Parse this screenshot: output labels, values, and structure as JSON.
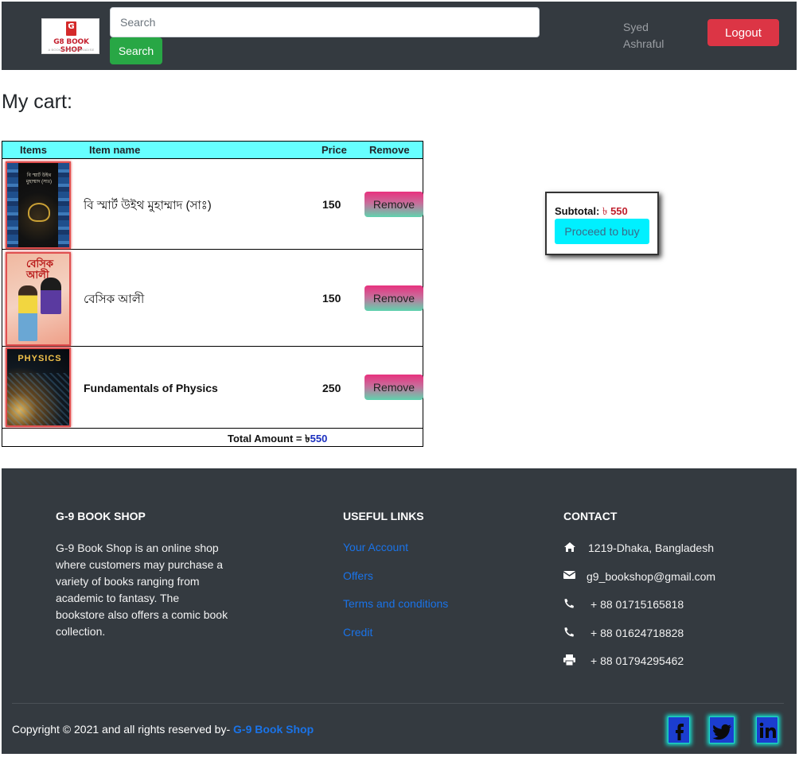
{
  "header": {
    "logo_name": "G8 BOOK SHOP",
    "logo_letter": "G",
    "logo_tagline": "A BOOK LOVERS PARADISE",
    "search_placeholder": "Search",
    "search_value": "",
    "search_button": "Search",
    "user_first": "Syed",
    "user_last": "Ashraful",
    "logout_button": "Logout"
  },
  "cart": {
    "heading": "My cart:",
    "columns": {
      "items": "Items",
      "name": "Item name",
      "price": "Price",
      "remove": "Remove"
    },
    "rows": [
      {
        "cover_title": "বি স্মার্ট উইথ মুহাম্মাদ (সাঃ)",
        "name": "বি স্মার্ট উইথ মুহাম্মাদ (সাঃ)",
        "price": "150",
        "remove_label": "Remove"
      },
      {
        "cover_title": "বেসিক আলী",
        "name": "বেসিক আলী",
        "price": "150",
        "remove_label": "Remove"
      },
      {
        "cover_title": "PHYSICS",
        "name": "Fundamentals of Physics",
        "price": "250",
        "remove_label": "Remove"
      }
    ],
    "total_label": "Total Amount =",
    "currency": "৳",
    "total_amount": "550"
  },
  "summary": {
    "subtotal_label": "Subtotal:",
    "currency": "৳",
    "subtotal_amount": "550",
    "proceed_button": "Proceed to buy"
  },
  "footer": {
    "about_heading": "G-9 BOOK SHOP",
    "about_text": "G-9 Book Shop is an online shop where customers may purchase a variety of books ranging from academic to fantasy. The bookstore also offers a comic book collection.",
    "links_heading": "USEFUL LINKS",
    "links": [
      "Your Account",
      "Offers",
      "Terms and conditions",
      "Credit"
    ],
    "contact_heading": "CONTACT",
    "contacts": [
      {
        "icon": "home-icon",
        "text": "1219-Dhaka, Bangladesh"
      },
      {
        "icon": "envelope-icon",
        "text": "g9_bookshop@gmail.com"
      },
      {
        "icon": "phone-icon",
        "text": "+ 88 01715165818"
      },
      {
        "icon": "phone-icon",
        "text": "+ 88 01624718828"
      },
      {
        "icon": "print-icon",
        "text": "+ 88 01794295462"
      }
    ],
    "copyright_text": "Copyright © 2021 and all rights reserved by-",
    "copyright_brand": "G-9 Book Shop",
    "social": [
      "facebook-icon",
      "twitter-icon",
      "linkedin-icon"
    ]
  },
  "colors": {
    "navbar_bg": "#343a40",
    "search_btn": "#28a745",
    "logout_btn": "#dc3545",
    "table_header_bg": "#66ffff",
    "proceed_btn": "#00f0ff",
    "link": "#1a73e8",
    "price_red": "#c0202e"
  }
}
